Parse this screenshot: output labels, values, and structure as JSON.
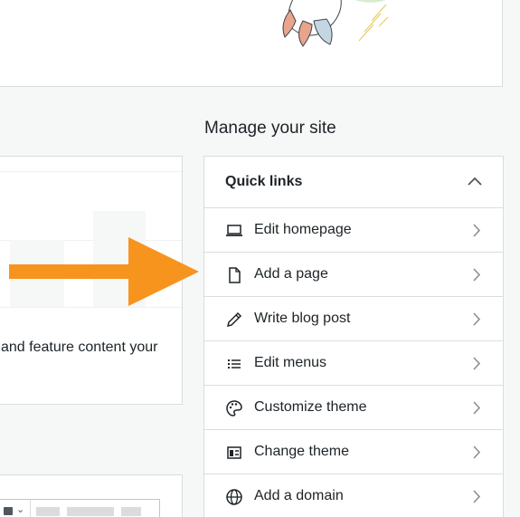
{
  "manage": {
    "title": "Manage your site"
  },
  "left_card": {
    "description": "and feature content your"
  },
  "quick_links": {
    "title": "Quick links",
    "items": [
      {
        "label": "Edit homepage",
        "icon": "laptop-icon"
      },
      {
        "label": "Add a page",
        "icon": "page-icon"
      },
      {
        "label": "Write blog post",
        "icon": "pencil-icon"
      },
      {
        "label": "Edit menus",
        "icon": "list-icon"
      },
      {
        "label": "Customize theme",
        "icon": "palette-icon"
      },
      {
        "label": "Change theme",
        "icon": "layout-icon"
      },
      {
        "label": "Add a domain",
        "icon": "globe-icon"
      }
    ]
  },
  "colors": {
    "arrow": "#f7941d",
    "border": "#dcdcde",
    "background": "#f6f7f7",
    "text": "#1d2327",
    "icon": "#50575e"
  }
}
